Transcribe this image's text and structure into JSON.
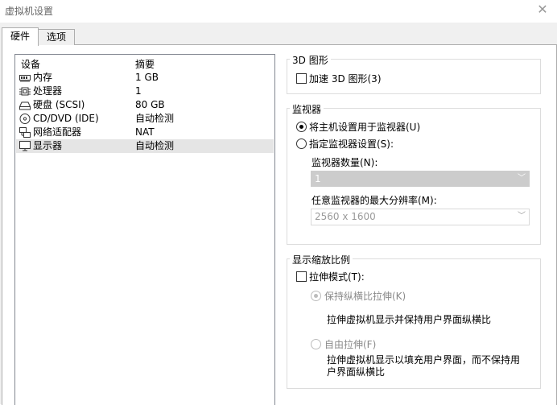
{
  "window": {
    "title": "虚拟机设置",
    "close_glyph": "✕"
  },
  "tabs": [
    {
      "label": "硬件"
    },
    {
      "label": "选项"
    }
  ],
  "devices": {
    "header_device": "设备",
    "header_summary": "摘要",
    "items": [
      {
        "name": "内存",
        "summary": "1 GB",
        "icon": "memory-icon"
      },
      {
        "name": "处理器",
        "summary": "1",
        "icon": "processor-icon"
      },
      {
        "name": "硬盘 (SCSI)",
        "summary": "80 GB",
        "icon": "hard-disk-icon"
      },
      {
        "name": "CD/DVD (IDE)",
        "summary": "自动检测",
        "icon": "cd-dvd-icon"
      },
      {
        "name": "网络适配器",
        "summary": "NAT",
        "icon": "network-adapter-icon"
      },
      {
        "name": "显示器",
        "summary": "自动检测",
        "icon": "display-icon",
        "selected": true
      }
    ]
  },
  "graphics3d": {
    "title": "3D 图形",
    "accelerate_label": "加速 3D 图形(3)",
    "accelerate_checked": false
  },
  "monitor": {
    "title": "监视器",
    "host_label": "将主机设置用于监视器(U)",
    "specify_label": "指定监视器设置(S):",
    "selected": "host",
    "count_label": "监视器数量(N):",
    "count_value": "1",
    "resolution_label": "任意监视器的最大分辨率(M):",
    "resolution_value": "2560 x 1600"
  },
  "scaling": {
    "title": "显示缩放比例",
    "stretch_label": "拉伸模式(T):",
    "stretch_checked": false,
    "keep_label": "保持纵横比拉伸(K)",
    "keep_desc": "拉伸虚拟机显示并保持用户界面纵横比",
    "free_label": "自由拉伸(F)",
    "free_desc": "拉伸虚拟机显示以填充用户界面，而不保持用户界面纵横比"
  },
  "colors": {
    "list_border": "#828790",
    "selected_row": "#e5e5e5",
    "disabled_combo": "#cccccc"
  }
}
